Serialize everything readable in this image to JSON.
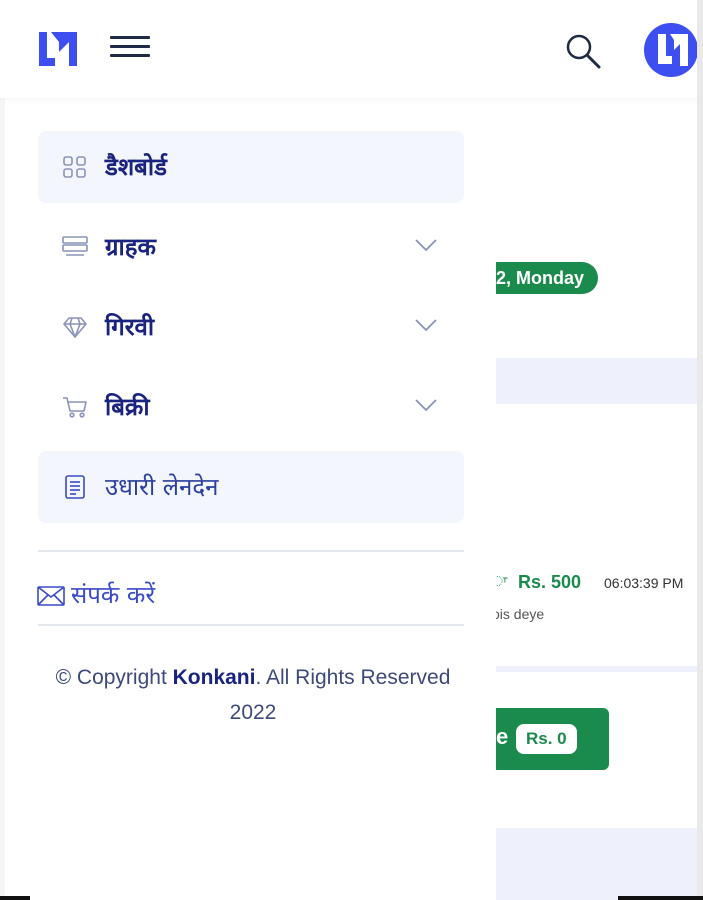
{
  "header": {
    "logo_icon": "brand-logo-icon",
    "menu_icon": "hamburger-icon",
    "search_icon": "search-icon",
    "avatar_icon": "brand-avatar-icon",
    "brand_color": "#3d4ff0"
  },
  "sidebar": {
    "items": [
      {
        "label": "डैशबोर्ड",
        "icon": "grid-icon",
        "active": true,
        "has_submenu": false
      },
      {
        "label": "ग्राहक",
        "icon": "list-icon",
        "active": false,
        "has_submenu": true
      },
      {
        "label": "गिरवी",
        "icon": "diamond-icon",
        "active": false,
        "has_submenu": true
      },
      {
        "label": "बिक्री",
        "icon": "cart-icon",
        "active": false,
        "has_submenu": true
      },
      {
        "label": "उधारी लेनदेन",
        "icon": "ledger-icon",
        "active": true,
        "has_submenu": false
      }
    ],
    "contact_label": "संपर्क करें",
    "contact_icon": "mail-icon",
    "copyright_prefix": "© Copyright ",
    "copyright_brand": "Konkani",
    "copyright_suffix": ". All Rights Reserved 2022"
  },
  "background": {
    "date_pill": "2, Monday",
    "amount": "Rs. 500",
    "time": "06:03:39 PM",
    "note": "ois deye",
    "button_text": "e",
    "button_badge": "Rs. 0",
    "accent_color": "#1a8a4d"
  }
}
